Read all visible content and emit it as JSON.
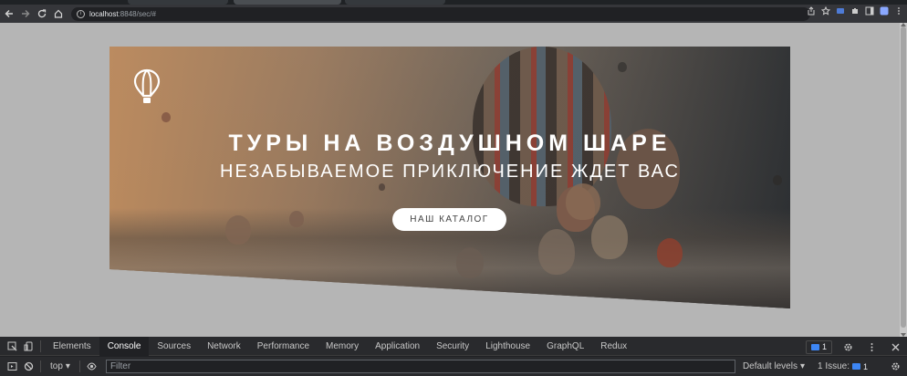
{
  "browser": {
    "url_host": "localhost",
    "url_path": ":8848/sec/#",
    "info_glyph": "i"
  },
  "hero": {
    "title": "ТУРЫ НА ВОЗДУШНОМ ШАРЕ",
    "subtitle": "НЕЗАБЫВАЕМОЕ ПРИКЛЮЧЕНИЕ ЖДЕТ ВАС",
    "button_label": "НАШ КАТАЛОГ"
  },
  "devtools": {
    "tabs": [
      "Elements",
      "Console",
      "Sources",
      "Network",
      "Performance",
      "Memory",
      "Application",
      "Security",
      "Lighthouse",
      "GraphQL",
      "Redux"
    ],
    "active_tab": "Console",
    "badge_count": "1",
    "context": "top",
    "filter_placeholder": "Filter",
    "levels_label": "Default levels",
    "issues_label": "1 Issue:",
    "issues_count": "1"
  },
  "colors": {
    "accent_blue": "#3d86f4",
    "page_bg": "#b5b5b5"
  }
}
